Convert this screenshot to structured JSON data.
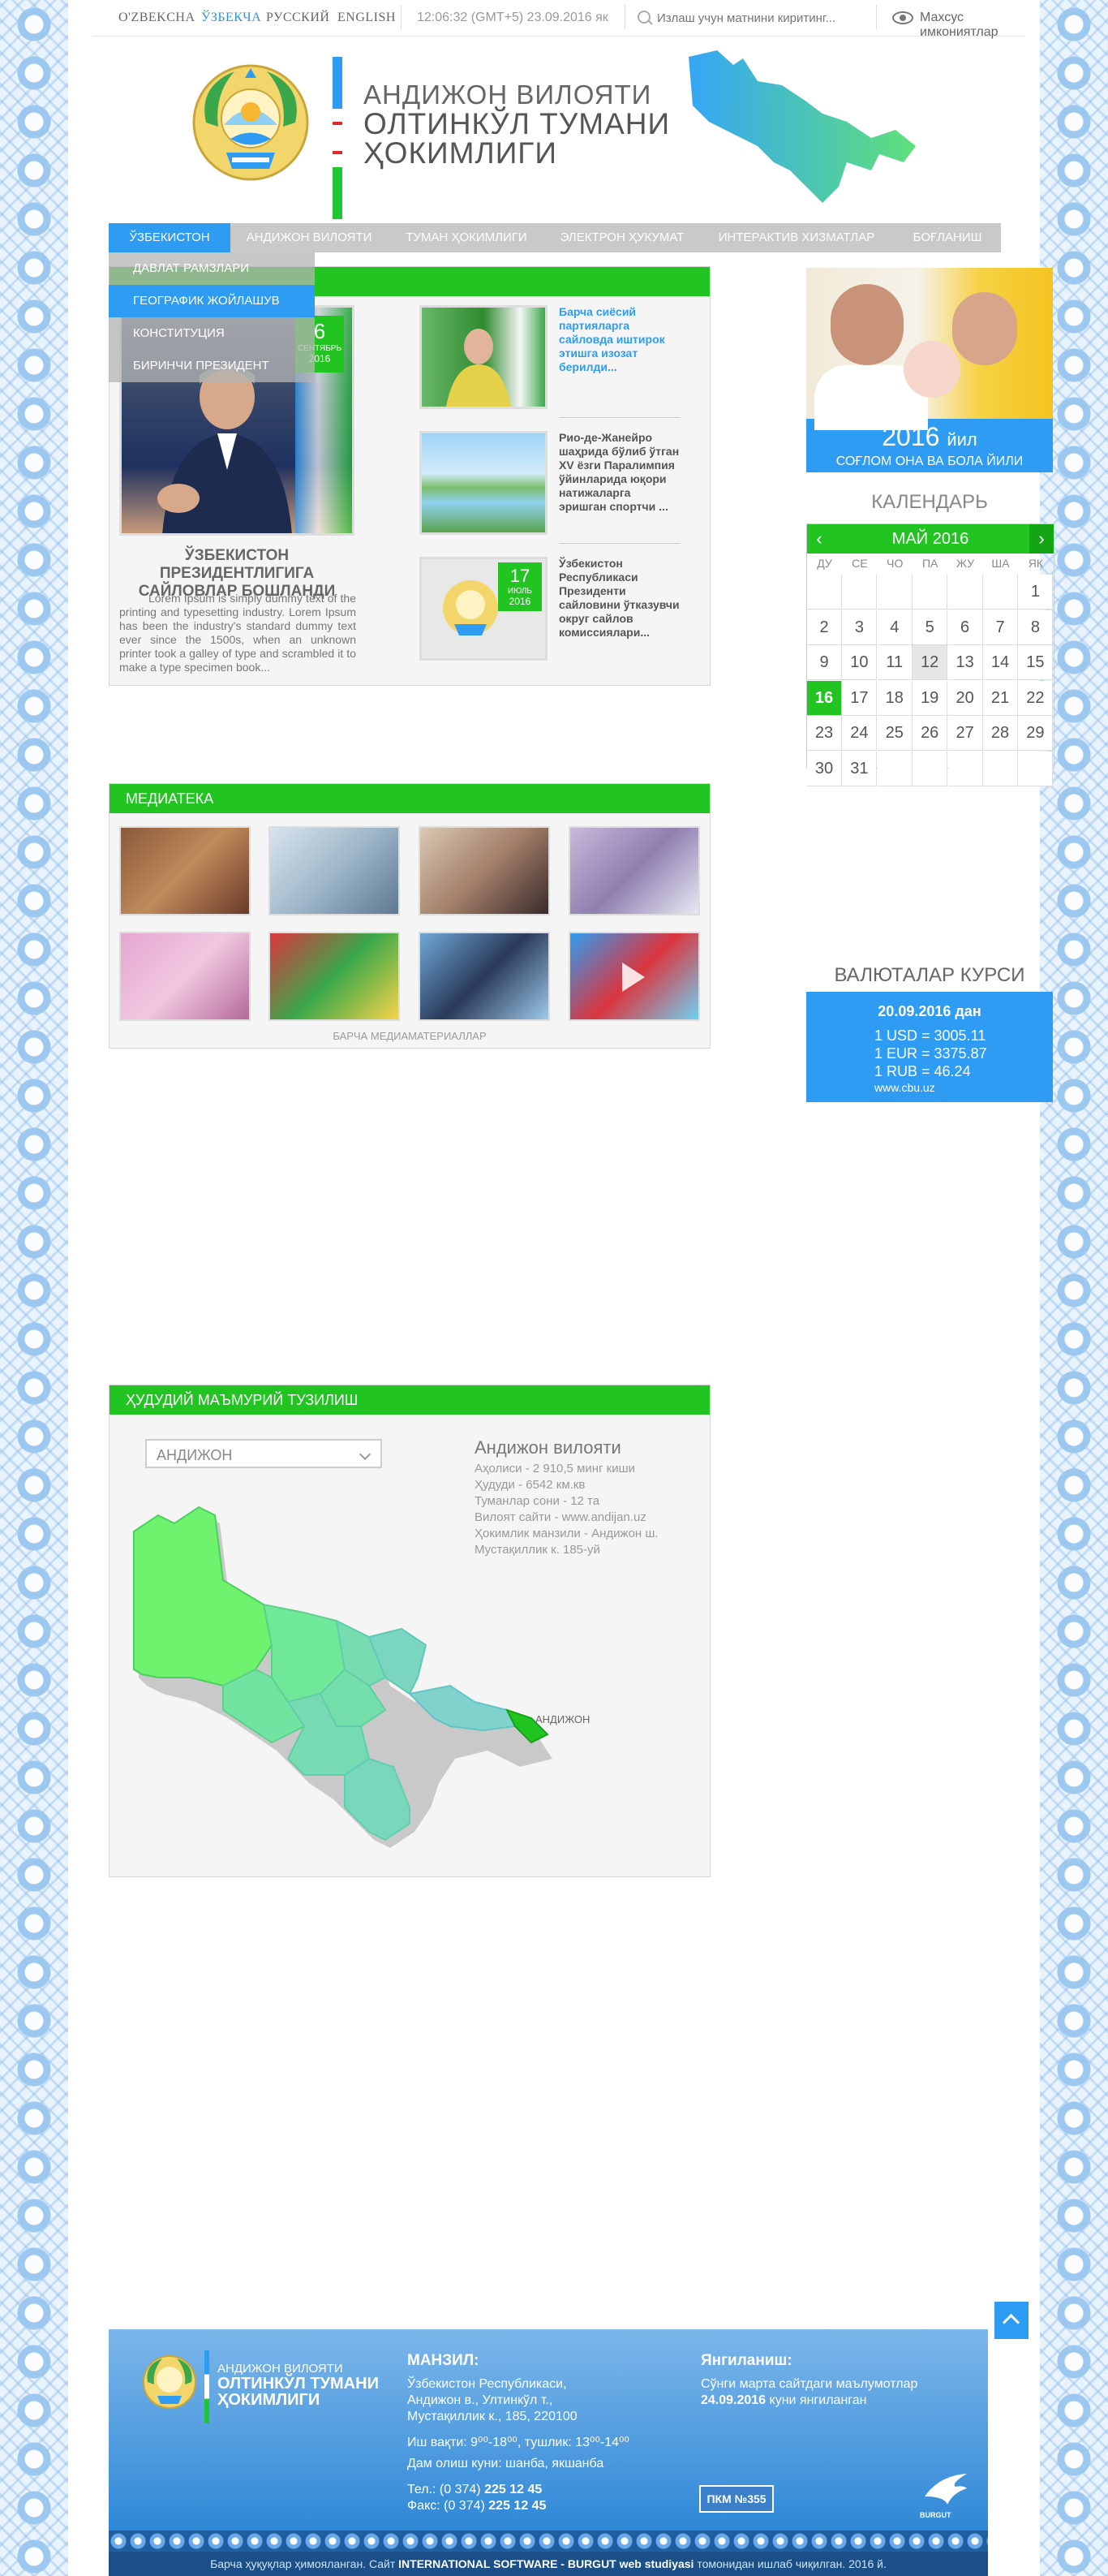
{
  "topbar": {
    "languages": [
      "O'ZBEKCHA",
      "ЎЗБЕКЧА",
      "РУССКИЙ",
      "ENGLISH"
    ],
    "active_language": "ЎЗБЕКЧА",
    "clock": "12:06:32 (GMT+5) 23.09.2016 як",
    "search_placeholder": "Излаш учун матнини киритинг...",
    "special_features": "Махсус имкониятлар"
  },
  "header": {
    "line1": "АНДИЖОН ВИЛОЯТИ",
    "line2": "ОЛТИНКЎЛ ТУМАНИ",
    "line3": "ҲОКИМЛИГИ"
  },
  "nav": {
    "items": [
      "ЎЗБЕКИСТОН",
      "АНДИЖОН ВИЛОЯТИ",
      "ТУМАН ҲОКИМЛИГИ",
      "ЭЛЕКТРОН ҲУКУМАТ",
      "ИНТЕРАКТИВ ХИЗМАТЛАР",
      "БОҒЛАНИШ"
    ],
    "active": "ЎЗБЕКИСТОН",
    "dropdown": [
      "ДАВЛАТ РАМЗЛАРИ",
      "ГЕОГРАФИК ЖОЙЛАШУВ",
      "КОНСТИТУЦИЯ",
      "БИРИНЧИ ПРЕЗИДЕНТ"
    ],
    "dropdown_highlight": "ГЕОГРАФИК ЖОЙЛАШУВ"
  },
  "news": {
    "main": {
      "day": "6",
      "month": "СЕНТЯБРЬ",
      "year": "2016",
      "title": "ЎЗБЕКИСТОН ПРЕЗИДЕНТЛИГИГА САЙЛОВЛАР БОШЛАНДИ",
      "text": "Lorem Ipsum is simply dummy text of the printing and typesetting industry. Lorem Ipsum has been the industry's standard dummy text ever since the 1500s, when an unknown printer took a galley of type and scrambled it to make a type specimen book..."
    },
    "side": [
      {
        "title": "Барча сиёсий партияларга сайловда иштирок этишга изозат берилди..."
      },
      {
        "title": "Рио-де-Жанейро шаҳрида бўлиб ўтган XV ёзги Паралимпия ўйинларида юқори натижаларга эришган спортчи ..."
      },
      {
        "title": "Ўзбекистон Республикаси Президенти сайловини ўтказувчи округ сайлов комиссиялари...",
        "day": "17",
        "month": "ИЮЛЬ",
        "year": "2016"
      }
    ]
  },
  "banner": {
    "year": "2016",
    "year_suffix": "йил",
    "subtitle": "СОҒЛОМ ОНА ВА БОЛА ЙИЛИ"
  },
  "calendar": {
    "title": "КАЛЕНДАРЬ",
    "month_label": "МАЙ 2016",
    "weekdays": [
      "ДУ",
      "СЕ",
      "ЧО",
      "ПА",
      "ЖУ",
      "ША",
      "ЯК"
    ],
    "days": [
      "",
      "",
      "",
      "",
      "",
      "",
      "1",
      "2",
      "3",
      "4",
      "5",
      "6",
      "7",
      "8",
      "9",
      "10",
      "11",
      "12",
      "13",
      "14",
      "15",
      "16",
      "17",
      "18",
      "19",
      "20",
      "21",
      "22",
      "23",
      "24",
      "25",
      "26",
      "27",
      "28",
      "29",
      "30",
      "31",
      "",
      "",
      "",
      "",
      ""
    ],
    "today": "16",
    "highlighted": "12"
  },
  "currency": {
    "title": "ВАЛЮТАЛАР КУРСИ",
    "date": "20.09.2016 дан",
    "rows": [
      "1 USD = 3005.11",
      "1 EUR = 3375.87",
      "1 RUB = 46.24"
    ],
    "source": "www.cbu.uz"
  },
  "media": {
    "title": "МЕДИАТЕКА",
    "all_link": "БАРЧА МЕДИАМАТЕРИАЛЛАР"
  },
  "admin": {
    "title": "ҲУДУДИЙ МАЪМУРИЙ ТУЗИЛИШ",
    "selected_region": "АНДИЖОН",
    "region_name": "Андижон вилояти",
    "facts": [
      "Аҳолиси - 2 910,5 минг киши",
      "Ҳудуди - 6542 км.кв",
      "Туманлар сони - 12 та",
      "Вилоят сайти - www.andijan.uz",
      "Ҳокимлик манзили - Андижон ш.",
      "Мустақиллик к. 185-уй"
    ],
    "map_label": "АНДИЖОН"
  },
  "footer": {
    "logo_line1": "АНДИЖОН ВИЛОЯТИ",
    "logo_line2": "ОЛТИНКЎЛ ТУМАНИ",
    "logo_line3": "ҲОКИМЛИГИ",
    "address_head": "МАНЗИЛ:",
    "address": [
      "Ўзбекистон Республикаси,",
      "Андижон в., Ултинкўл т.,",
      "Мустақиллик к., 185, 220100"
    ],
    "hours": "Иш вақти: 9⁰⁰-18⁰⁰, тушлик: 13⁰⁰-14⁰⁰",
    "days_off": "Дам олиш куни: шанба, якшанба",
    "phone_label": "Тел.: (0 374)",
    "phone": "225 12 45",
    "fax_label": "Факс: (0 374)",
    "fax": "225 12 45",
    "updates_head": "Янгиланиш:",
    "updates_text": "Сўнги марта сайтдаги маълумотлар",
    "updates_date": "24.09.2016",
    "updates_suffix": "куни янгиланган",
    "counter": "ПКМ №355",
    "developer_logo_text": "BURGUT",
    "copyright_pre": "Барча ҳуқуқлар ҳимояланган. Сайт",
    "copyright_bold": "INTERNATIONAL SOFTWARE - BURGUT web studiyasi",
    "copyright_post": "томонидан ишлаб чиқилган. 2016 й."
  },
  "colors": {
    "accent_blue": "#2f9cf3",
    "accent_green": "#21c421",
    "nav_gray": "#c9c9c9"
  }
}
